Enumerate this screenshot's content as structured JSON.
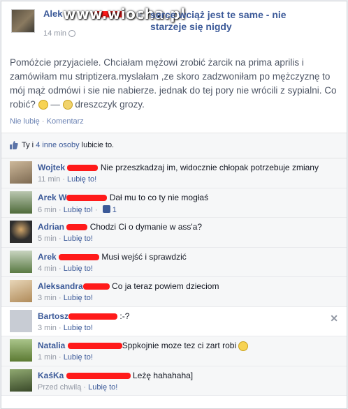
{
  "post": {
    "author_prefix": "Alek",
    "watermark": "www.wiocha.pl",
    "shared_title": "serce wciąż jest te same - nie starzeje się nigdy",
    "time": "14 min",
    "body_1": "Pomóżcie przyjaciele. Chciałam mężowi zrobić żarcik na prima aprilis i zamówiłam mu striptizera.myslałam ,ze skoro zadzwoniłam po mężczyznę to mój mąż odmówi i sie nie nabierze. jednak do tej pory nie wrócili z sypialni. Co robić?",
    "body_2": "—",
    "body_3": "dreszczyk grozy.",
    "action_like": "Nie lubię",
    "action_comment": "Komentarz"
  },
  "likes": {
    "prefix": "Ty i",
    "link": "4 inne osoby",
    "suffix": "lubicie to."
  },
  "comments": [
    {
      "name": "Wojtek",
      "text": "Nie przeszkadzaj im, widocznie chłopak potrzebuje zmiany",
      "time": "11 min",
      "like": "Lubię to!",
      "likes": ""
    },
    {
      "name": "Arek W",
      "text": "Dał mu to co ty nie mogłaś",
      "time": "6 min",
      "like": "Lubię to!",
      "likes": "1"
    },
    {
      "name": "Adrian",
      "text": "Chodzi Ci o dymanie w ass'a?",
      "time": "5 min",
      "like": "Lubię to!",
      "likes": ""
    },
    {
      "name": "Arek",
      "text": "Musi wejść i sprawdzić",
      "time": "4 min",
      "like": "Lubię to!",
      "likes": ""
    },
    {
      "name": "Aleksandra",
      "text": "Co ja teraz powiem dzieciom",
      "time": "3 min",
      "like": "Lubię to!",
      "likes": ""
    },
    {
      "name": "Bartosz",
      "text": ":-?",
      "time": "3 min",
      "like": "Lubię to!",
      "likes": ""
    },
    {
      "name": "Natalia",
      "text": "Sppkojnie moze tez ci zart robi",
      "time": "1 min",
      "like": "Lubię to!",
      "likes": ""
    },
    {
      "name": "KaśKa",
      "text": "Leżę hahahaha]",
      "time": "Przed chwilą",
      "like": "Lubię to!",
      "likes": ""
    }
  ],
  "colors": {
    "link": "#3b5998",
    "redaction": "#ff1a1a",
    "muted": "#9197a3"
  }
}
